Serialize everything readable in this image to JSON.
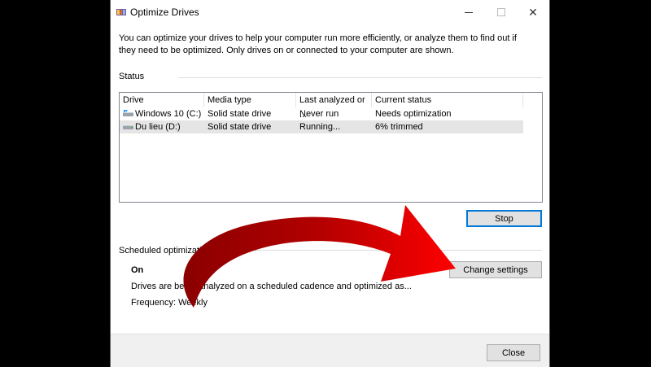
{
  "window": {
    "title": "Optimize Drives",
    "intro": "You can optimize your drives to help your computer run more efficiently, or analyze them to find out if they need to be optimized. Only drives on or connected to your computer are shown."
  },
  "status": {
    "label": "Status",
    "columns": [
      "Drive",
      "Media type",
      "Last analyzed or ...",
      "Current status"
    ],
    "rows": [
      {
        "drive": "Windows 10 (C:)",
        "media": "Solid state drive",
        "last": "Never run",
        "current": "Needs optimization"
      },
      {
        "drive": "Du lieu (D:)",
        "media": "Solid state drive",
        "last": "Running...",
        "current": "6% trimmed"
      }
    ],
    "stop_label": "Stop"
  },
  "scheduled": {
    "label": "Scheduled optimization",
    "state": "On",
    "description": "Drives are being analyzed on a scheduled cadence and optimized as...",
    "frequency": "Frequency: Weekly",
    "change_label": "Change settings"
  },
  "footer": {
    "close_label": "Close"
  },
  "colors": {
    "arrow": "#cc0000",
    "focus": "#0078d7"
  }
}
